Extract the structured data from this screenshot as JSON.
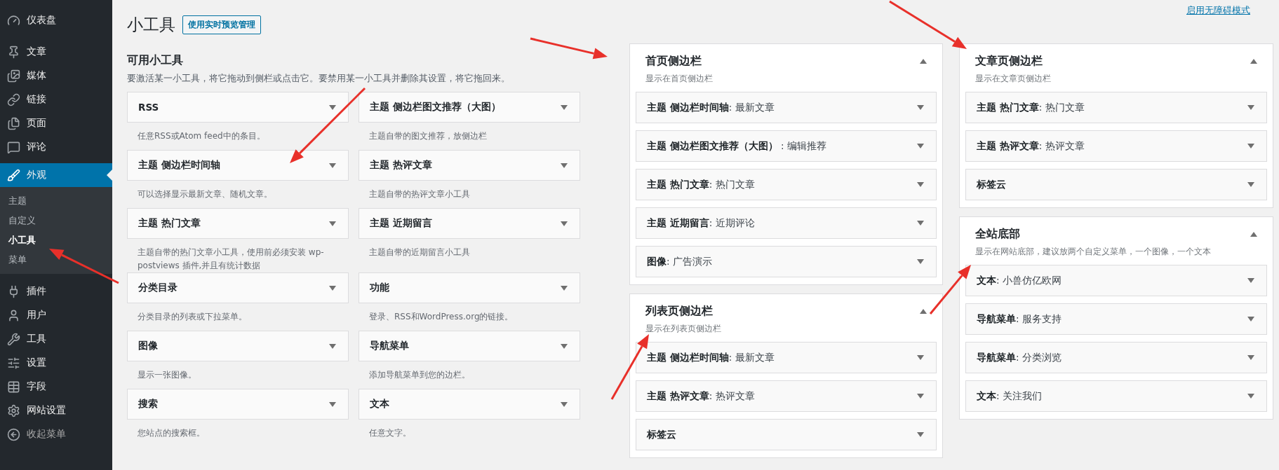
{
  "sidebar": {
    "items": [
      {
        "label": "仪表盘",
        "selected": false
      },
      {
        "label": "文章",
        "selected": false
      },
      {
        "label": "媒体",
        "selected": false
      },
      {
        "label": "链接",
        "selected": false
      },
      {
        "label": "页面",
        "selected": false
      },
      {
        "label": "评论",
        "selected": false
      },
      {
        "label": "外观",
        "selected": true,
        "children": [
          {
            "label": "主题",
            "selected": false
          },
          {
            "label": "自定义",
            "selected": false
          },
          {
            "label": "小工具",
            "selected": true
          },
          {
            "label": "菜单",
            "selected": false
          }
        ]
      },
      {
        "label": "插件",
        "selected": false
      },
      {
        "label": "用户",
        "selected": false
      },
      {
        "label": "工具",
        "selected": false
      },
      {
        "label": "设置",
        "selected": false
      },
      {
        "label": "字段",
        "selected": false
      },
      {
        "label": "网站设置",
        "selected": false
      }
    ],
    "collapse": "收起菜单"
  },
  "page": {
    "title": "小工具",
    "action_button": "使用实时预览管理",
    "accessibility_link": "启用无障碍模式"
  },
  "available": {
    "title": "可用小工具",
    "description": "要激活某一小工具，将它拖动到侧栏或点击它。要禁用某一小工具并删除其设置，将它拖回来。",
    "widgets": [
      {
        "title": "RSS",
        "description": "任意RSS或Atom feed中的条目。"
      },
      {
        "title": "主题 侧边栏图文推荐（大图）",
        "description": "主题自带的图文推荐，放侧边栏"
      },
      {
        "title": "主题 侧边栏时间轴",
        "description": "可以选择显示最新文章、随机文章。"
      },
      {
        "title": "主题 热评文章",
        "description": "主题自带的热评文章小工具"
      },
      {
        "title": "主题 热门文章",
        "description": "主题自带的热门文章小工具，使用前必须安装 wp-postviews 插件,并且有统计数据"
      },
      {
        "title": "主题 近期留言",
        "description": "主题自带的近期留言小工具"
      },
      {
        "title": "分类目录",
        "description": "分类目录的列表或下拉菜单。"
      },
      {
        "title": "功能",
        "description": "登录、RSS和WordPress.org的链接。"
      },
      {
        "title": "图像",
        "description": "显示一张图像。"
      },
      {
        "title": "导航菜单",
        "description": "添加导航菜单到您的边栏。"
      },
      {
        "title": "搜索",
        "description": "您站点的搜索框。"
      },
      {
        "title": "文本",
        "description": "任意文字。"
      }
    ]
  },
  "sidebars": [
    {
      "title": "首页侧边栏",
      "description": "显示在首页侧边栏",
      "expanded": true,
      "widgets": [
        "**主题 侧边栏时间轴**: 最新文章",
        "**主题 侧边栏图文推荐（大图）** : 编辑推荐",
        "**主题 热门文章**: 热门文章",
        "**主题 近期留言**: 近期评论",
        "**图像**: 广告演示"
      ]
    },
    {
      "title": "列表页侧边栏",
      "description": "显示在列表页侧边栏",
      "expanded": true,
      "widgets": [
        "**主题 侧边栏时间轴**: 最新文章",
        "**主题 热评文章**: 热评文章",
        "**标签云**"
      ]
    },
    {
      "title": "文章页侧边栏",
      "description": "显示在文章页侧边栏",
      "expanded": true,
      "widgets": [
        "**主题 热门文章**: 热门文章",
        "**主题 热评文章**: 热评文章",
        "**标签云**"
      ]
    },
    {
      "title": "全站底部",
      "description": "显示在网站底部，建议放两个自定义菜单，一个图像，一个文本",
      "expanded": true,
      "widgets": [
        "**文本**: 小兽仿亿欧网",
        "**导航菜单**: 服务支持",
        "**导航菜单**: 分类浏览",
        "**文本**: 关注我们"
      ]
    }
  ]
}
